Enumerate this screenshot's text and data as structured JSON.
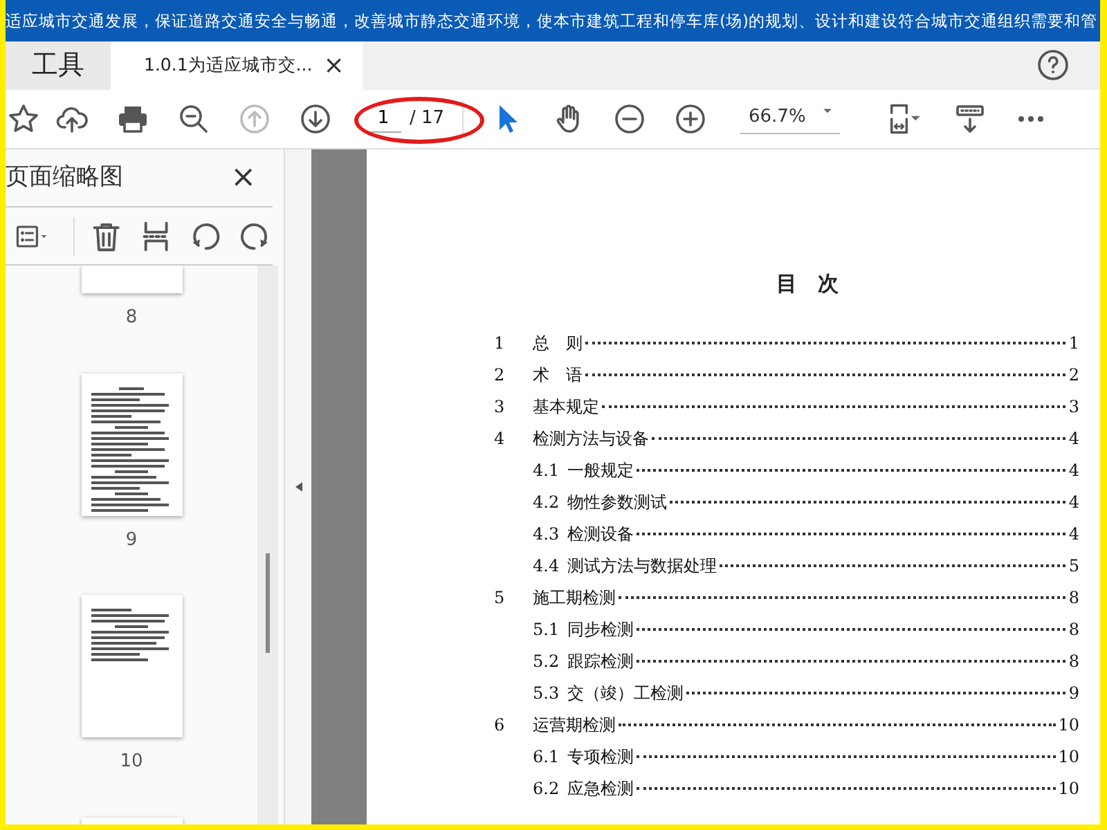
{
  "banner": {
    "text": "适应城市交通发展，保证道路交通安全与畅通，改善城市静态交通环境，使本市建筑工程和停车库(场)的规划、设计和建设符合城市交通组织需要和管"
  },
  "tabs": [
    {
      "kind": "home",
      "label": "工具",
      "selected": false
    },
    {
      "kind": "document",
      "label": "1.0.1为适应城市交...",
      "selected": true,
      "close": "×"
    }
  ],
  "toolbar": {
    "prev_page": {
      "disabled": true
    },
    "next_page": {
      "disabled": false
    },
    "page_current": "1",
    "page_total": "/ 17",
    "zoom": "66.7%"
  },
  "sidebar": {
    "title": "页面缩略图",
    "close": "×",
    "thumbnails": [
      {
        "label": "8",
        "kind": "cut"
      },
      {
        "label": "9",
        "kind": "dense"
      },
      {
        "label": "10",
        "kind": "short"
      },
      {
        "kind": "partial"
      }
    ]
  },
  "document": {
    "title": "目　次",
    "toc": [
      {
        "number": "1",
        "title": "总　则",
        "page": "1"
      },
      {
        "number": "2",
        "title": "术　语",
        "page": "2"
      },
      {
        "number": "3",
        "title": "基本规定",
        "page": "3"
      },
      {
        "number": "4",
        "title": "检测方法与设备",
        "page": "4",
        "children": [
          {
            "number": "4.1",
            "title": "一般规定",
            "page": "4"
          },
          {
            "number": "4.2",
            "title": "物性参数测试",
            "page": "4"
          },
          {
            "number": "4.3",
            "title": "检测设备",
            "page": "4"
          },
          {
            "number": "4.4",
            "title": "测试方法与数据处理",
            "page": "5"
          }
        ]
      },
      {
        "number": "5",
        "title": "施工期检测",
        "page": "8",
        "children": [
          {
            "number": "5.1",
            "title": "同步检测",
            "page": "8"
          },
          {
            "number": "5.2",
            "title": "跟踪检测",
            "page": "8"
          },
          {
            "number": "5.3",
            "title": "交（竣）工检测",
            "page": "9"
          }
        ]
      },
      {
        "number": "6",
        "title": "运营期检测",
        "page": "10",
        "children": [
          {
            "number": "6.1",
            "title": "专项检测",
            "page": "10"
          },
          {
            "number": "6.2",
            "title": "应急检测",
            "page": "10"
          }
        ]
      }
    ]
  }
}
